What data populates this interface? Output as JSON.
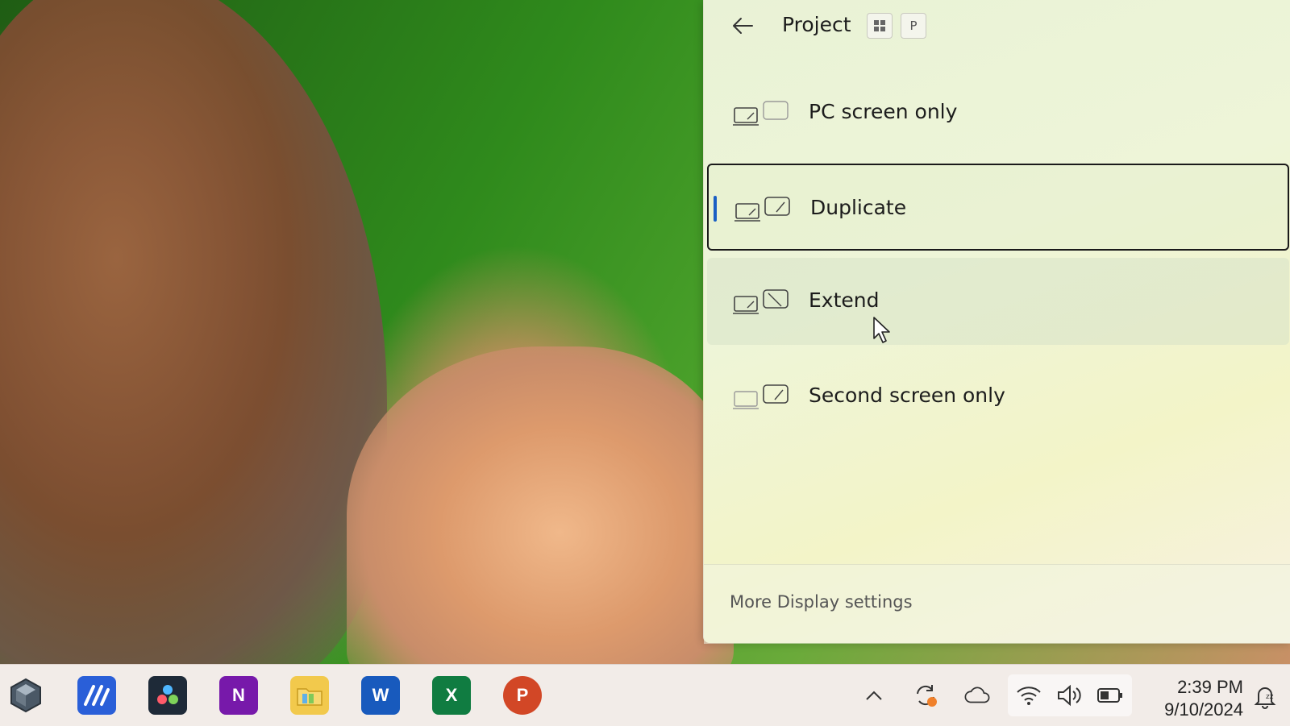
{
  "flyout": {
    "title": "Project",
    "shortcut_keys": [
      "Win",
      "P"
    ],
    "options": [
      {
        "label": "PC screen only",
        "icon": "pc-screen-only-icon",
        "selected": false
      },
      {
        "label": "Duplicate",
        "icon": "duplicate-icon",
        "selected": true
      },
      {
        "label": "Extend",
        "icon": "extend-icon",
        "selected": false
      },
      {
        "label": "Second screen only",
        "icon": "second-screen-only-icon",
        "selected": false
      }
    ],
    "footer_link": "More Display settings"
  },
  "taskbar": {
    "apps": [
      {
        "name": "app-launcher-icon",
        "color": "#3a4a5a"
      },
      {
        "name": "copilot-style-app-icon",
        "color": "#2a5fd8"
      },
      {
        "name": "davinci-resolve-icon",
        "color": "#1e2a38"
      },
      {
        "name": "onenote-icon",
        "color": "#7719aa",
        "glyph": "N"
      },
      {
        "name": "file-explorer-icon",
        "color": "#f2c94c"
      },
      {
        "name": "word-icon",
        "color": "#185abd",
        "glyph": "W"
      },
      {
        "name": "excel-icon",
        "color": "#107c41",
        "glyph": "X"
      },
      {
        "name": "powerpoint-icon",
        "color": "#d24726",
        "glyph": "P"
      }
    ],
    "clock": {
      "time": "2:39 PM",
      "date": "9/10/2024"
    }
  }
}
